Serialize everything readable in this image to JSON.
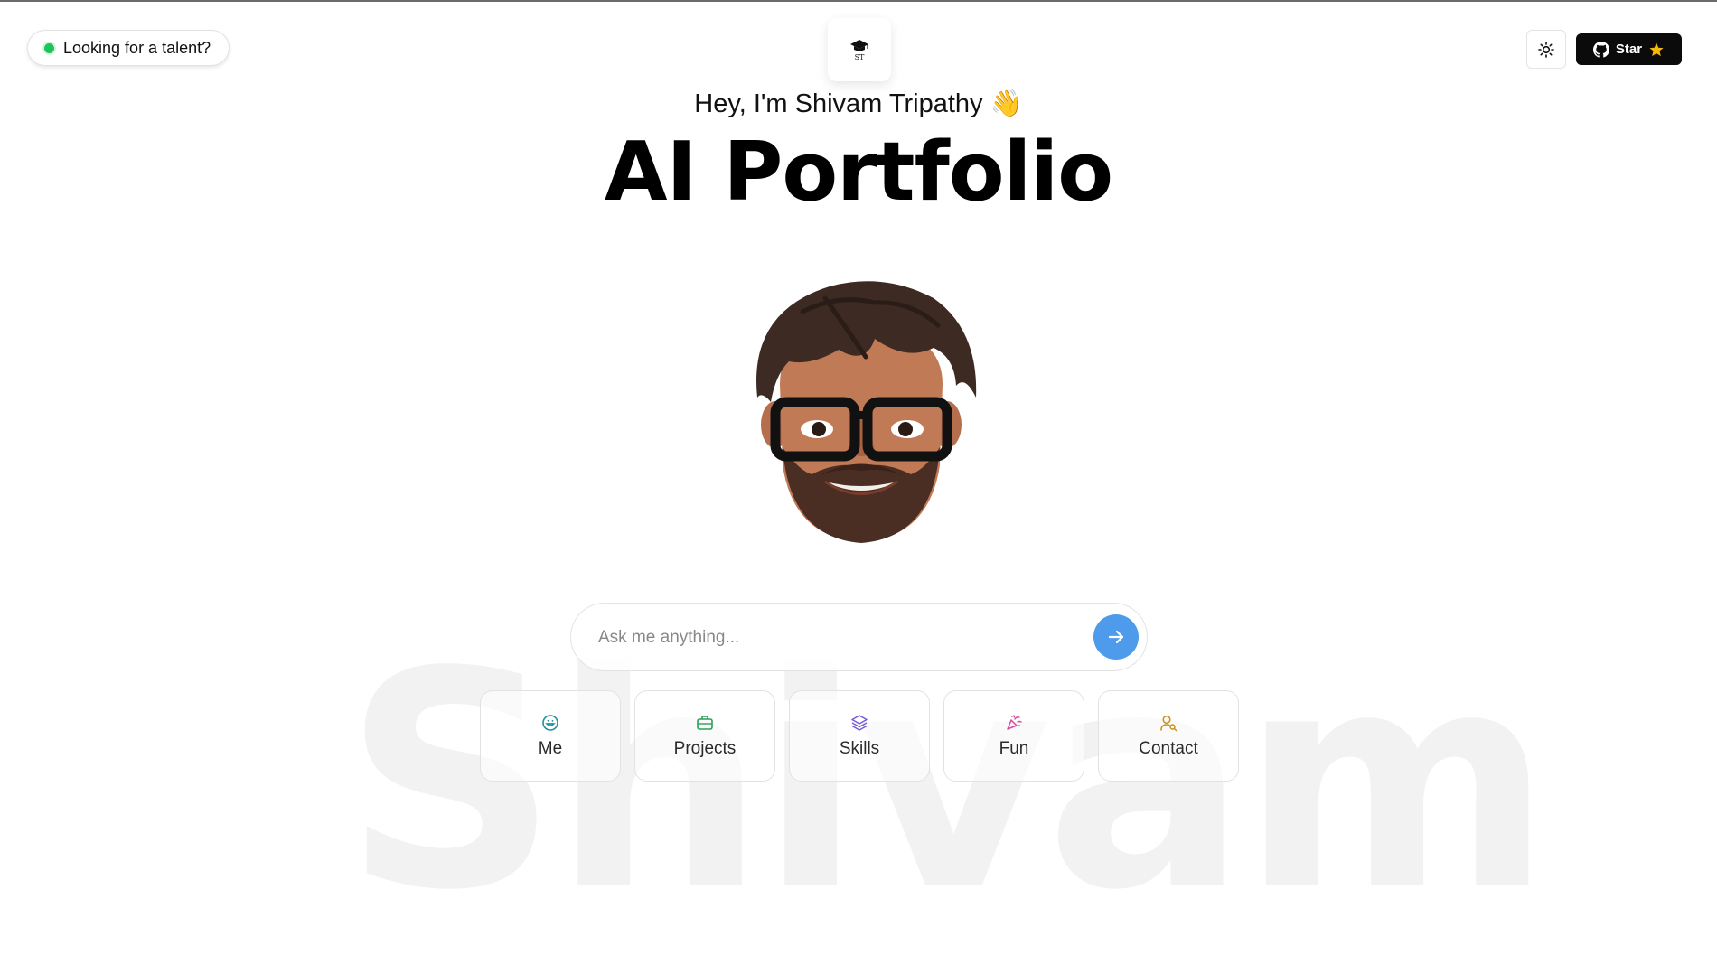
{
  "header": {
    "talent_label": "Looking for a talent?",
    "logo_text": "ST",
    "github_label": "Star"
  },
  "hero": {
    "greeting": "Hey, I'm Shivam Tripathy 👋",
    "title": "AI Portfolio",
    "background_word": "Shivam"
  },
  "chat": {
    "placeholder": "Ask me anything..."
  },
  "quick_links": [
    {
      "label": "Me",
      "icon": "smile-icon",
      "color": "#1f8fa3"
    },
    {
      "label": "Projects",
      "icon": "briefcase-icon",
      "color": "#2e9e5b"
    },
    {
      "label": "Skills",
      "icon": "layers-icon",
      "color": "#7a5ad6"
    },
    {
      "label": "Fun",
      "icon": "party-popper-icon",
      "color": "#d64c9a"
    },
    {
      "label": "Contact",
      "icon": "user-search-icon",
      "color": "#c9901b"
    }
  ],
  "colors": {
    "status": "#1fc35b",
    "send_button": "#4d9bea",
    "github_button": "#0b0b0b",
    "star": "#f5b90a"
  }
}
